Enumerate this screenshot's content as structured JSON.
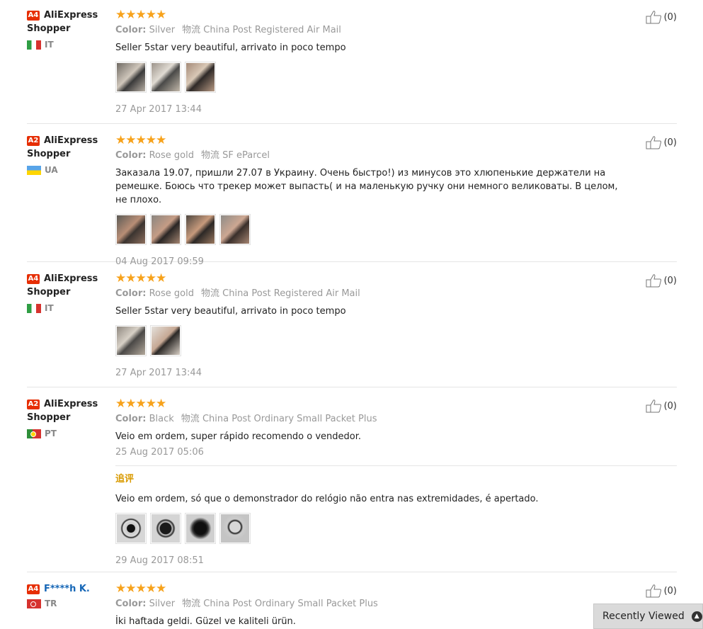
{
  "reviews": [
    {
      "level": "A4",
      "name": "AliExpress Shopper",
      "country": "IT",
      "stars": "★★★★★",
      "color_label": "Color:",
      "color": "Silver",
      "shipping_label": "物流",
      "shipping": "China Post Registered Air Mail",
      "text": "Seller 5star very beautiful, arrivato in poco tempo",
      "date": "27 Apr 2017 13:44",
      "likes": "(0)"
    },
    {
      "level": "A2",
      "name": "AliExpress Shopper",
      "country": "UA",
      "stars": "★★★★★",
      "color_label": "Color:",
      "color": "Rose gold",
      "shipping_label": "物流",
      "shipping": "SF eParcel",
      "text": "Заказала 19.07, пришли 27.07 в Украину. Очень быстро!) из минусов это хлюпенькие держатели на ремешке. Боюсь что трекер может выпасть( и на маленькую ручку они немного великоваты. В целом, не плохо.",
      "date": "04 Aug 2017 09:59",
      "likes": "(0)"
    },
    {
      "level": "A4",
      "name": "AliExpress Shopper",
      "country": "IT",
      "stars": "★★★★★",
      "color_label": "Color:",
      "color": "Rose gold",
      "shipping_label": "物流",
      "shipping": "China Post Registered Air Mail",
      "text": "Seller 5star very beautiful, arrivato in poco tempo",
      "date": "27 Apr 2017 13:44",
      "likes": "(0)"
    },
    {
      "level": "A2",
      "name": "AliExpress Shopper",
      "country": "PT",
      "stars": "★★★★★",
      "color_label": "Color:",
      "color": "Black",
      "shipping_label": "物流",
      "shipping": "China Post Ordinary Small Packet Plus",
      "text": "Veio em ordem, super rápido recomendo o vendedor.",
      "date": "25 Aug 2017 05:06",
      "likes": "(0)",
      "followup_title": "追评",
      "followup_text": "Veio em ordem, só que o demonstrador do relógio não entra nas extremidades, é apertado.",
      "followup_date": "29 Aug 2017 08:51"
    },
    {
      "level": "A4",
      "name": "F****h K.",
      "country": "TR",
      "stars": "★★★★★",
      "color_label": "Color:",
      "color": "Silver",
      "shipping_label": "物流",
      "shipping": "China Post Ordinary Small Packet Plus",
      "text": "İki haftada geldi. Güzel ve kaliteli ürün.",
      "likes": "(0)"
    }
  ],
  "recently_viewed": "Recently Viewed"
}
